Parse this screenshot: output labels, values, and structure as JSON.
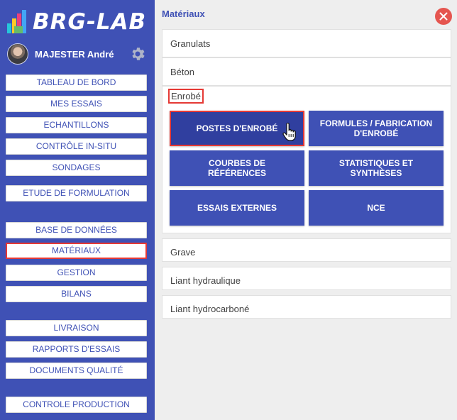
{
  "brand": {
    "name": "BRG-LAB"
  },
  "user": {
    "name": "MAJESTER André"
  },
  "sidebar": {
    "items": [
      {
        "label": "TABLEAU DE BORD"
      },
      {
        "label": "MES ESSAIS"
      },
      {
        "label": "ECHANTILLONS"
      },
      {
        "label": "CONTRÔLE IN-SITU"
      },
      {
        "label": "SONDAGES"
      },
      {
        "label": "ETUDE DE FORMULATION"
      },
      {
        "label": "BASE DE DONNÉES"
      },
      {
        "label": "MATÉRIAUX",
        "active": true
      },
      {
        "label": "GESTION"
      },
      {
        "label": "BILANS"
      },
      {
        "label": "LIVRAISON"
      },
      {
        "label": "RAPPORTS D'ESSAIS"
      },
      {
        "label": "DOCUMENTS QUALITÉ"
      },
      {
        "label": "CONTROLE PRODUCTION"
      }
    ]
  },
  "main": {
    "title": "Matériaux",
    "categories": [
      {
        "label": "Granulats"
      },
      {
        "label": "Béton"
      },
      {
        "label": "Enrobé",
        "expanded": true
      },
      {
        "label": "Grave"
      },
      {
        "label": "Liant hydraulique"
      },
      {
        "label": "Liant hydrocarboné"
      }
    ],
    "enrobe_tiles": [
      {
        "label": "POSTES D'ENROBÉ",
        "active": true
      },
      {
        "label": "FORMULES / FABRICATION D'ENROBÉ"
      },
      {
        "label": "COURBES DE RÉFÉRENCES"
      },
      {
        "label": "STATISTIQUES ET SYNTHÈSES"
      },
      {
        "label": "ESSAIS EXTERNES"
      },
      {
        "label": "NCE"
      }
    ]
  },
  "icons": {
    "settings": "gear-icon",
    "close": "close-icon",
    "cursor": "hand-pointer-icon",
    "logo": "brg-lab-logo-icon"
  },
  "colors": {
    "primary": "#3f51b5",
    "primary_dark": "#303f9f",
    "highlight": "#e53935",
    "close": "#e5554f",
    "background": "#eeeeee"
  }
}
